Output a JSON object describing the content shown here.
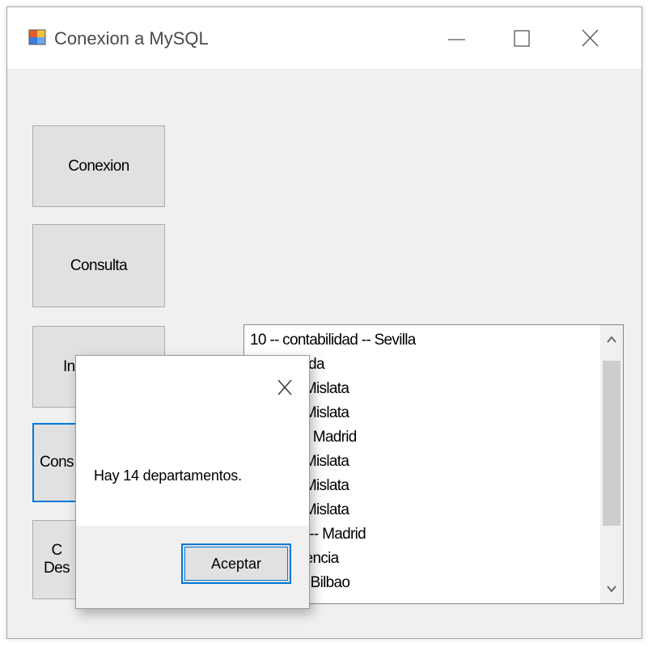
{
  "window": {
    "title": "Conexion a MySQL",
    "controls": {
      "minimize": "minimize-icon",
      "maximize": "maximize-icon",
      "close": "close-icon"
    }
  },
  "buttons": {
    "conexion": "Conexion",
    "consulta": "Consulta",
    "third_partial": "In",
    "fourth_partial": "Cons",
    "fifth_partial_line1": "C",
    "fifth_partial_line2": "Des"
  },
  "listbox": {
    "items": [
      "10 -- contabilidad -- Sevilla",
      "lo -- Neruda",
      "keting -- Mislata",
      "keting -- Mislata",
      "rmatica -- Madrid",
      "keting -- Mislata",
      "keting -- Mislata",
      "keting -- Mislata",
      "stigación -- Madrid",
      "tas -- Valencia",
      "lucción -- Bilbao"
    ]
  },
  "dialog": {
    "message": "Hay 14 departamentos.",
    "ok_label": "Aceptar"
  },
  "colors": {
    "accent": "#0078d7",
    "window_bg": "#f0f0f0",
    "button_bg": "#e1e1e1"
  }
}
